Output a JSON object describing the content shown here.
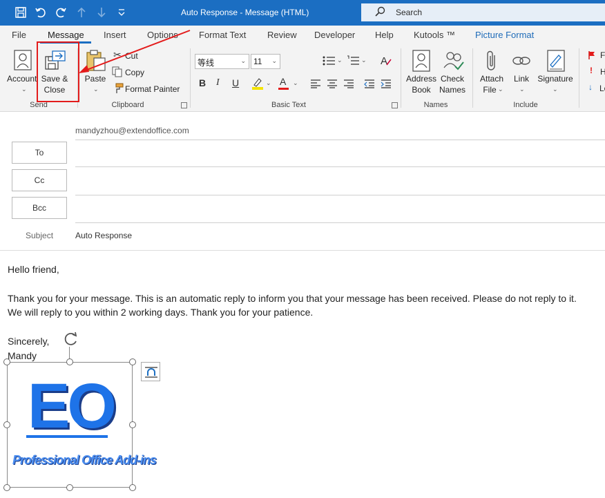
{
  "window": {
    "title": "Auto Response  -  Message (HTML)",
    "search_placeholder": "Search"
  },
  "tabs": [
    {
      "label": "File"
    },
    {
      "label": "Message"
    },
    {
      "label": "Insert"
    },
    {
      "label": "Options"
    },
    {
      "label": "Format Text"
    },
    {
      "label": "Review"
    },
    {
      "label": "Developer"
    },
    {
      "label": "Help"
    },
    {
      "label": "Kutools ™"
    },
    {
      "label": "Picture Format"
    }
  ],
  "ribbon": {
    "send": {
      "account_label": "Account",
      "save_close_label_1": "Save &",
      "save_close_label_2": "Close",
      "group_label": "Send"
    },
    "clipboard": {
      "paste_label": "Paste",
      "cut_label": "Cut",
      "copy_label": "Copy",
      "format_painter_label": "Format Painter",
      "group_label": "Clipboard"
    },
    "basic_text": {
      "font_name": "等线",
      "font_size": "11",
      "bold": "B",
      "italic": "I",
      "underline": "U",
      "font_color_glyph": "A",
      "group_label": "Basic Text"
    },
    "names": {
      "address_book_1": "Address",
      "address_book_2": "Book",
      "check_names_1": "Check",
      "check_names_2": "Names",
      "group_label": "Names"
    },
    "include": {
      "attach_file_1": "Attach",
      "attach_file_2": "File",
      "link_label": "Link",
      "signature_label": "Signature",
      "group_label": "Include"
    },
    "tags_partial": [
      "F",
      "H",
      "Lo"
    ]
  },
  "header": {
    "from": "mandyzhou@extendoffice.com",
    "to_label": "To",
    "cc_label": "Cc",
    "bcc_label": "Bcc",
    "subject_label": "Subject",
    "subject_value": "Auto Response"
  },
  "body": {
    "greeting": "Hello friend,",
    "line1": "Thank you for your message. This is an automatic reply to inform you that your message has been received. Please do not reply to it.",
    "line2": "We will reply to you within 2 working days. Thank you for your patience.",
    "closing": "Sincerely,",
    "name": "Mandy"
  },
  "logo": {
    "mark": "EO",
    "tagline": "Professional Office Add-ins"
  },
  "colors": {
    "titlebar": "#1b6ec2",
    "accent": "#1b6ec2",
    "annotation": "#e31b1b",
    "logo_blue": "#1e73e8"
  }
}
